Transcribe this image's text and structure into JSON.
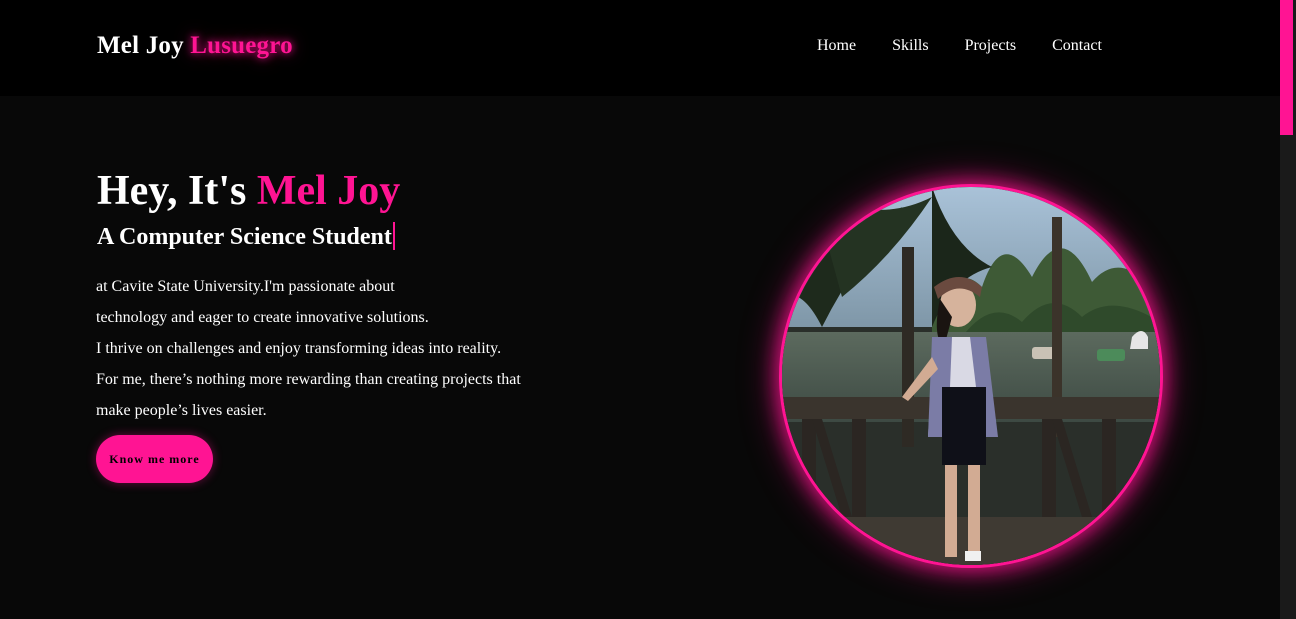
{
  "header": {
    "logo_first": "Mel Joy",
    "logo_accent": "Lusuegro",
    "nav": [
      "Home",
      "Skills",
      "Projects",
      "Contact"
    ]
  },
  "hero": {
    "title_prefix": "Hey, It's",
    "title_accent": "Mel Joy",
    "subtitle": "A Computer Science Student",
    "bio_lines": [
      "at Cavite State University.I'm passionate about",
      "technology and eager to create innovative solutions.",
      "I thrive on challenges and enjoy transforming ideas into reality.",
      "For me, there’s nothing more rewarding than creating projects that",
      "make people’s lives easier."
    ],
    "cta_label": "Know me more"
  },
  "colors": {
    "accent": "#ff1493",
    "header_bg": "#000000",
    "page_bg": "#080808",
    "text": "#ffffff"
  },
  "icons": {
    "portrait": "profile-photo"
  }
}
